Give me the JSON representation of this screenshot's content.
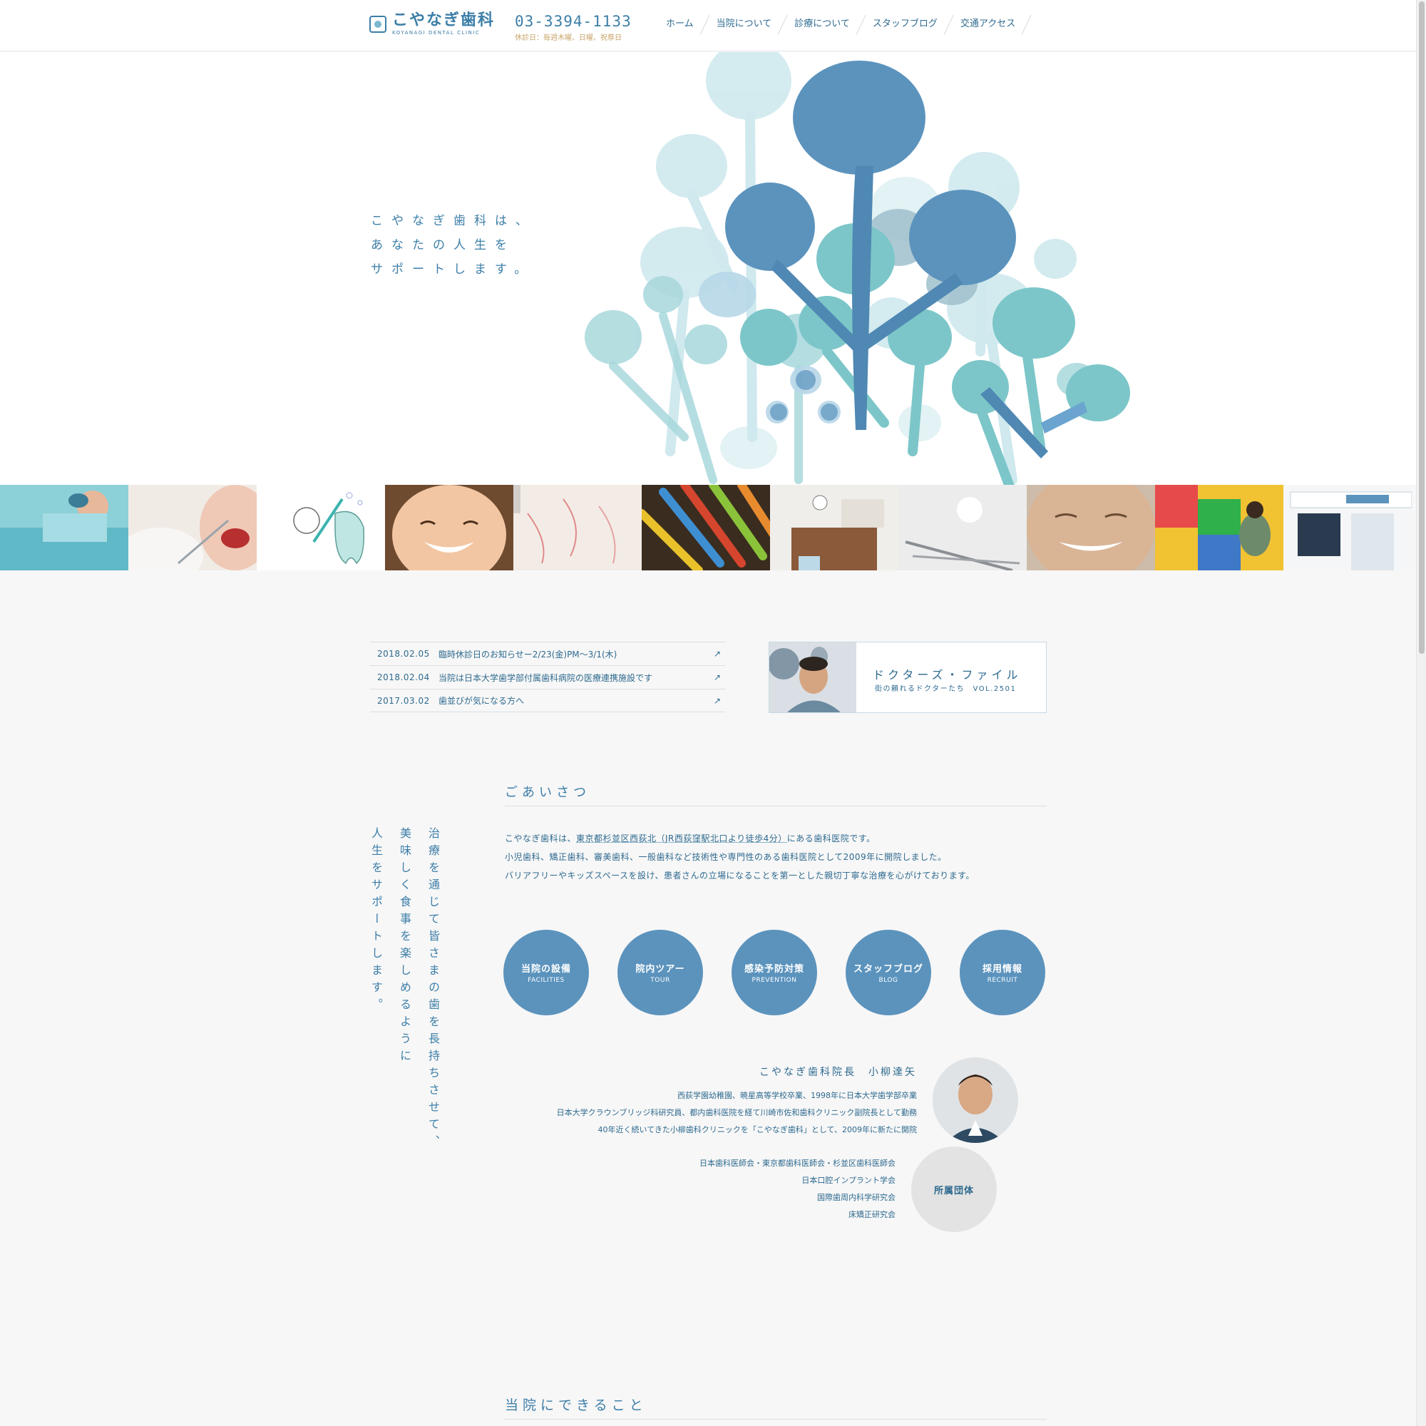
{
  "header": {
    "logo_name": "こやなぎ歯科",
    "logo_sub": "KOYANAGI DENTAL CLINIC",
    "tel": "03-3394-1133",
    "hours": "休診日：毎週木曜、日曜、祝祭日",
    "nav": [
      "ホーム",
      "当院について",
      "診療について",
      "スタッフブログ",
      "交通アクセス"
    ]
  },
  "hero": {
    "copy_lines": [
      "こやなぎ歯科は、",
      "あなたの人生を",
      "サポートします。"
    ]
  },
  "strip": {
    "tiles": [
      "surgery",
      "dental-mirror",
      "tooth-illustration",
      "smiling-child",
      "drawing",
      "toothbrushes",
      "reception",
      "dental-tools",
      "smiling-elder",
      "kids-space",
      "clinic-exterior"
    ]
  },
  "news": [
    {
      "date": "2018.02.05",
      "title": "臨時休診日のお知らせー2/23(金)PM〜3/1(木)"
    },
    {
      "date": "2018.02.04",
      "title": "当院は日本大学歯学部付属歯科病院の医療連携施設です"
    },
    {
      "date": "2017.03.02",
      "title": "歯並びが気になる方へ"
    }
  ],
  "banner": {
    "title": "ドクターズ・ファイル",
    "sub": "街の頼れるドクターたち　VOL.2501"
  },
  "vertical_copy": [
    "治療を通じて皆さまの歯を長持ちさせて、",
    "美味しく食事を楽しめるように",
    "人生をサポートします。"
  ],
  "greeting": {
    "title": "ごあいさつ",
    "line1_a": "こやなぎ歯科は、",
    "line1_link": "東京都杉並区西荻北（JR西荻窪駅北口より徒歩4分）",
    "line1_b": "にある歯科医院です。",
    "line2": "小児歯科、矯正歯科、審美歯科、一般歯科など技術性や専門性のある歯科医院として2009年に開院しました。",
    "line3": "バリアフリーやキッズスペースを設け、患者さんの立場になることを第一とした親切丁寧な治療を心がけております。"
  },
  "circles": [
    {
      "jp": "当院の設備",
      "en": "FACILITIES"
    },
    {
      "jp": "院内ツアー",
      "en": "TOUR"
    },
    {
      "jp": "感染予防対策",
      "en": "PREVENTION"
    },
    {
      "jp": "スタッフブログ",
      "en": "BLOG"
    },
    {
      "jp": "採用情報",
      "en": "RECRUIT"
    }
  ],
  "director": {
    "name": "こやなぎ歯科院長　小柳達矢",
    "cv": [
      "西荻学園幼稚園、暁星高等学校卒業、1998年に日本大学歯学部卒業",
      "日本大学クラウンブリッジ科研究員、都内歯科医院を経て川崎市佐和歯科クリニック副院長として勤務",
      "40年近く続いてきた小柳歯科クリニックを「こやなぎ歯科」として、2009年に新たに開院"
    ]
  },
  "affiliations": {
    "label": "所属団体",
    "items": [
      "日本歯科医師会・東京都歯科医師会・杉並区歯科医師会",
      "日本口腔インプラント学会",
      "国際歯周内科学研究会",
      "床矯正研究会"
    ]
  },
  "can_do": {
    "title": "当院にできること"
  },
  "colors": {
    "brand": "#3c7ea8",
    "circle": "#5b93bd",
    "accent_gold": "#c9a46a"
  }
}
